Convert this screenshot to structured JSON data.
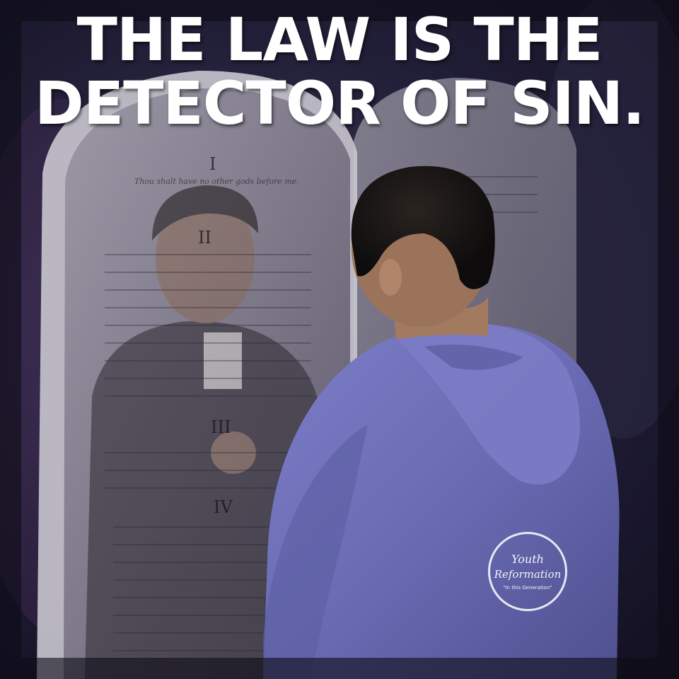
{
  "headline": {
    "line1": "THE LAW IS THE",
    "line2": "DETECTOR OF SIN."
  },
  "tablet": {
    "numerals": [
      "I",
      "II",
      "III",
      "IV"
    ],
    "first_line": "Thou shalt have no other gods before me."
  },
  "logo": {
    "line1": "Youth",
    "line2": "Reformation",
    "line3": "\"In this Generation\""
  },
  "colors": {
    "hoodie": "#6e6fb8",
    "tablet": "#8a8794",
    "background": "#1c1a2e",
    "text": "#ffffff"
  }
}
